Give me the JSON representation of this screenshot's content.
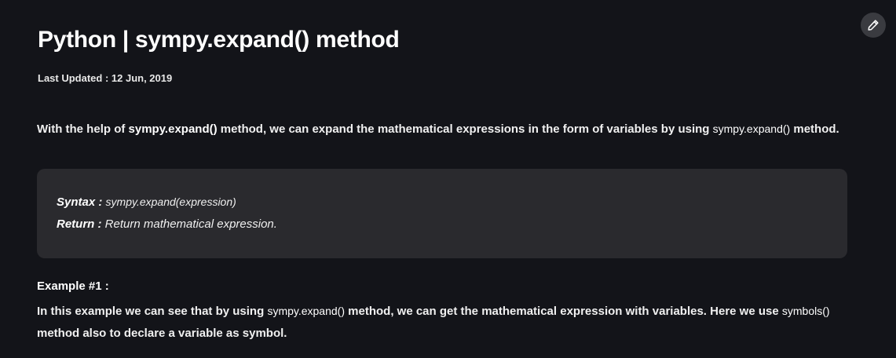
{
  "article": {
    "title": "Python | sympy.expand() method",
    "last_updated": "Last Updated : 12 Jun, 2019"
  },
  "intro": {
    "part1": "With the help of ",
    "code1": "sympy.expand()",
    "part2": " method, we can expand the mathematical expressions in the form of variables by using ",
    "code2": "sympy.expand()",
    "part3": " method."
  },
  "syntax_box": {
    "syntax_label": "Syntax : ",
    "syntax_value": "sympy.expand(expression)",
    "return_label": "Return : ",
    "return_value": "Return mathematical expression."
  },
  "example": {
    "heading": "Example #1 :",
    "part1": "In this example we can see that by using ",
    "code1": "sympy.expand()",
    "part2": " method, we can get the mathematical expression with variables. Here we use ",
    "code2": "symbols()",
    "part3": " method also to declare a variable as symbol."
  },
  "icons": {
    "edit": "pencil-icon"
  }
}
